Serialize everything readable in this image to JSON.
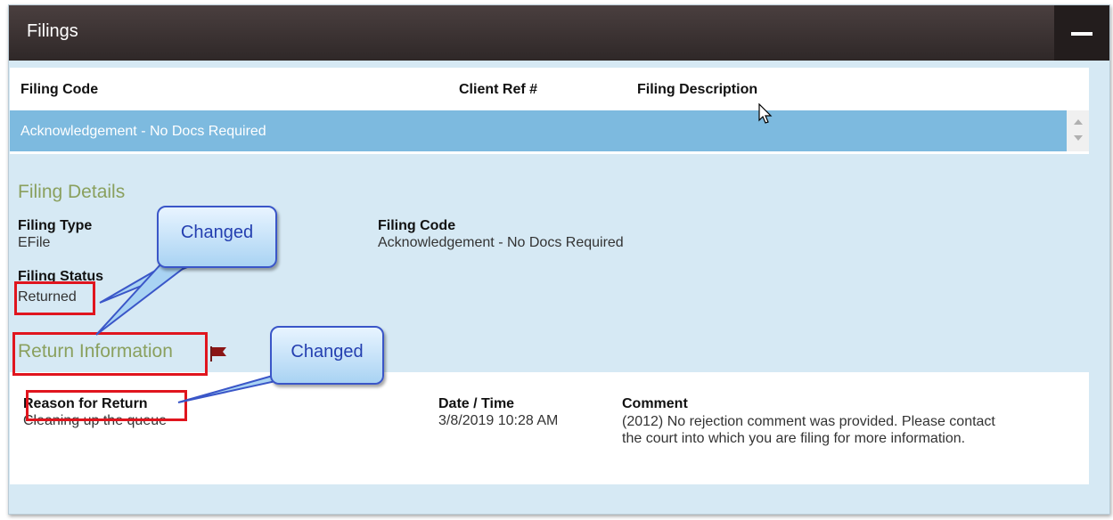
{
  "header": {
    "title": "Filings"
  },
  "grid": {
    "columns": [
      "Filing Code",
      "Client Ref #",
      "Filing Description"
    ],
    "selected_row": "Acknowledgement - No Docs Required"
  },
  "filing_details": {
    "title": "Filing Details",
    "filing_type_label": "Filing Type",
    "filing_type_value": "EFile",
    "filing_status_label": "Filing Status",
    "filing_status_value": "Returned",
    "filing_code_label": "Filing Code",
    "filing_code_value": "Acknowledgement - No Docs Required"
  },
  "return_info": {
    "title": "Return Information",
    "reason_label": "Reason for Return",
    "reason_value": "Cleaning up the queue",
    "datetime_label": "Date / Time",
    "datetime_value": "3/8/2019 10:28 AM",
    "comment_label": "Comment",
    "comment_value": "(2012) No rejection comment was provided. Please contact the court into which you are filing for more information."
  },
  "callouts": [
    "Changed",
    "Changed"
  ],
  "colors": {
    "header": "#352c2c",
    "selected_row": "#7dbadf",
    "section_title": "#8aa05e",
    "highlight": "#e0151e",
    "callout_border": "#3a56c8"
  },
  "icons": [
    "minus-icon",
    "flag-icon",
    "cursor-icon",
    "scroll-up-icon",
    "scroll-down-icon"
  ]
}
